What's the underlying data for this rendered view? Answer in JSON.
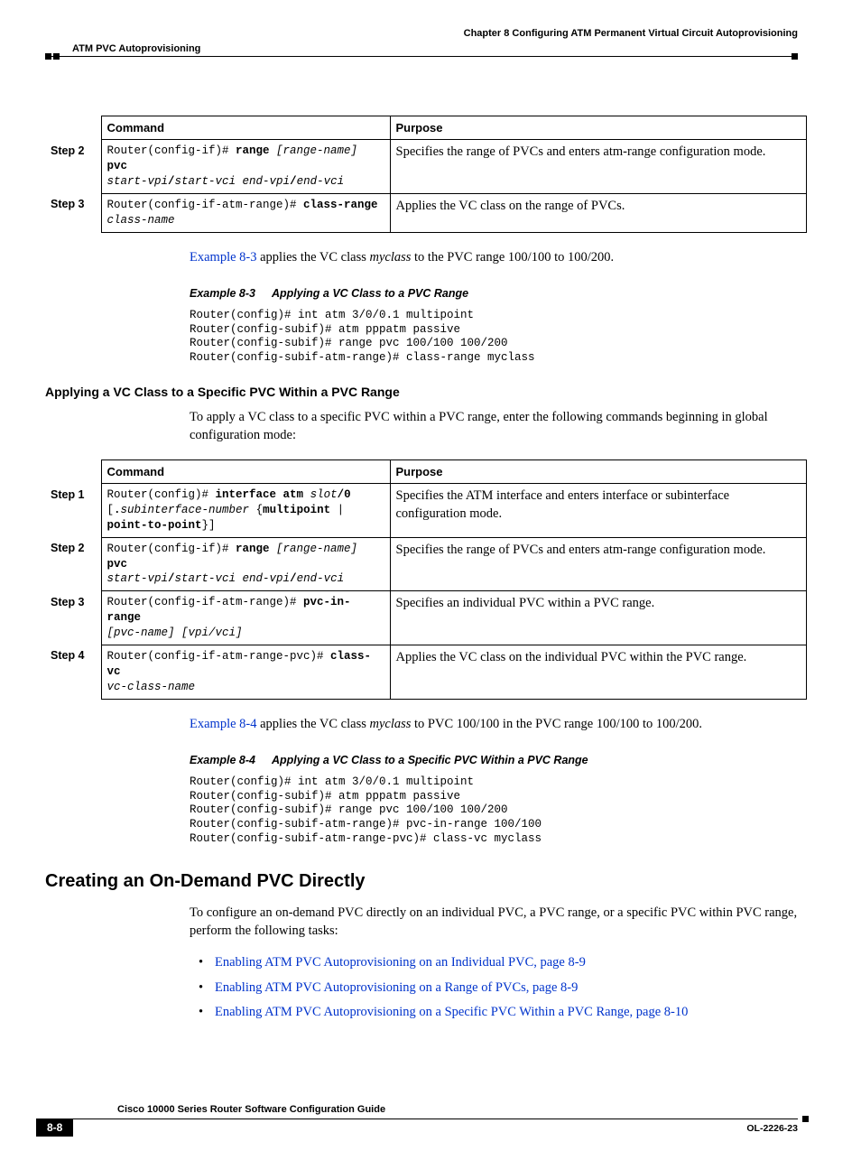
{
  "header": {
    "chapter": "Chapter 8      Configuring ATM Permanent Virtual Circuit Autoprovisioning",
    "section": "ATM PVC Autoprovisioning"
  },
  "table1": {
    "head_command": "Command",
    "head_purpose": "Purpose",
    "s2_label": "Step 2",
    "s2_prompt": "Router(config-if)# ",
    "s2_b1": "range",
    "s2_i1": " [range-name] ",
    "s2_b2": "pvc",
    "s2_line2a": "start-vpi",
    "s2_slash1": "/",
    "s2_line2b": "start-vci end-vpi",
    "s2_slash2": "/",
    "s2_line2c": "end-vci",
    "s2_purpose": "Specifies the range of PVCs and enters atm-range configuration mode.",
    "s3_label": "Step 3",
    "s3_prompt": "Router(config-if-atm-range)# ",
    "s3_b1": "class-range",
    "s3_i1": "class-name",
    "s3_purpose": "Applies the VC class on the range of PVCs."
  },
  "para1": {
    "link": "Example 8-3",
    "t1": " applies the VC class ",
    "em": "myclass",
    "t2": " to the PVC range 100/100 to 100/200."
  },
  "example83": {
    "num": "Example 8-3",
    "title": "Applying a VC Class to a PVC Range",
    "code": "Router(config)# int atm 3/0/0.1 multipoint\nRouter(config-subif)# atm pppatm passive\nRouter(config-subif)# range pvc 100/100 100/200\nRouter(config-subif-atm-range)# class-range myclass"
  },
  "h3_1": "Applying a VC Class to a Specific PVC Within a PVC Range",
  "para2": "To apply a VC class to a specific PVC within a PVC range, enter the following commands beginning in global configuration mode:",
  "table2": {
    "head_command": "Command",
    "head_purpose": "Purpose",
    "s1_label": "Step 1",
    "s1_prompt": "Router(config)# ",
    "s1_b1": "interface atm ",
    "s1_i1": "slot",
    "s1_b2": "/0",
    "s1_line2a": "[",
    "s1_line2b": ".",
    "s1_line2c": "subinterface-number",
    "s1_line2d": " {",
    "s1_line2e": "multipoint",
    "s1_line2f": " | ",
    "s1_line3a": "point-to-point",
    "s1_line3b": "}]",
    "s1_purpose": "Specifies the ATM interface and enters interface or subinterface configuration mode.",
    "s2_label": "Step 2",
    "s2_prompt": "Router(config-if)# ",
    "s2_b1": "range",
    "s2_i1": " [range-name] ",
    "s2_b2": "pvc",
    "s2_line2a": "start-vpi",
    "s2_slash1": "/",
    "s2_line2b": "start-vci end-vpi",
    "s2_slash2": "/",
    "s2_line2c": "end-vci",
    "s2_purpose": "Specifies the range of PVCs and enters atm-range configuration mode.",
    "s3_label": "Step 3",
    "s3_prompt": "Router(config-if-atm-range)# ",
    "s3_b1": "pvc-in-range",
    "s3_line2": "[pvc-name] [vpi/vci]",
    "s3_purpose": "Specifies an individual PVC within a PVC range.",
    "s4_label": "Step 4",
    "s4_prompt": "Router(config-if-atm-range-pvc)# ",
    "s4_b1": "class-vc",
    "s4_i1": "vc-class-name",
    "s4_purpose": "Applies the VC class on the individual PVC within the PVC range."
  },
  "para3": {
    "link": "Example 8-4",
    "t1": " applies the VC class ",
    "em": "myclass",
    "t2": " to PVC 100/100 in the PVC range 100/100 to 100/200."
  },
  "example84": {
    "num": "Example 8-4",
    "title": "Applying a VC Class to a Specific PVC Within a PVC Range",
    "code": "Router(config)# int atm 3/0/0.1 multipoint\nRouter(config-subif)# atm pppatm passive\nRouter(config-subif)# range pvc 100/100 100/200\nRouter(config-subif-atm-range)# pvc-in-range 100/100\nRouter(config-subif-atm-range-pvc)# class-vc myclass"
  },
  "h2_1": "Creating an On-Demand PVC Directly",
  "para4": "To configure an on-demand PVC directly on an individual PVC, a PVC range, or a specific PVC within PVC range, perform the following tasks:",
  "tasks": {
    "t1": "Enabling ATM PVC Autoprovisioning on an Individual PVC, page 8-9",
    "t2": "Enabling ATM PVC Autoprovisioning on a Range of PVCs, page 8-9",
    "t3": "Enabling ATM PVC Autoprovisioning on a Specific PVC Within a PVC Range, page 8-10"
  },
  "footer": {
    "guide": "Cisco 10000 Series Router Software Configuration Guide",
    "page": "8-8",
    "docid": "OL-2226-23"
  }
}
